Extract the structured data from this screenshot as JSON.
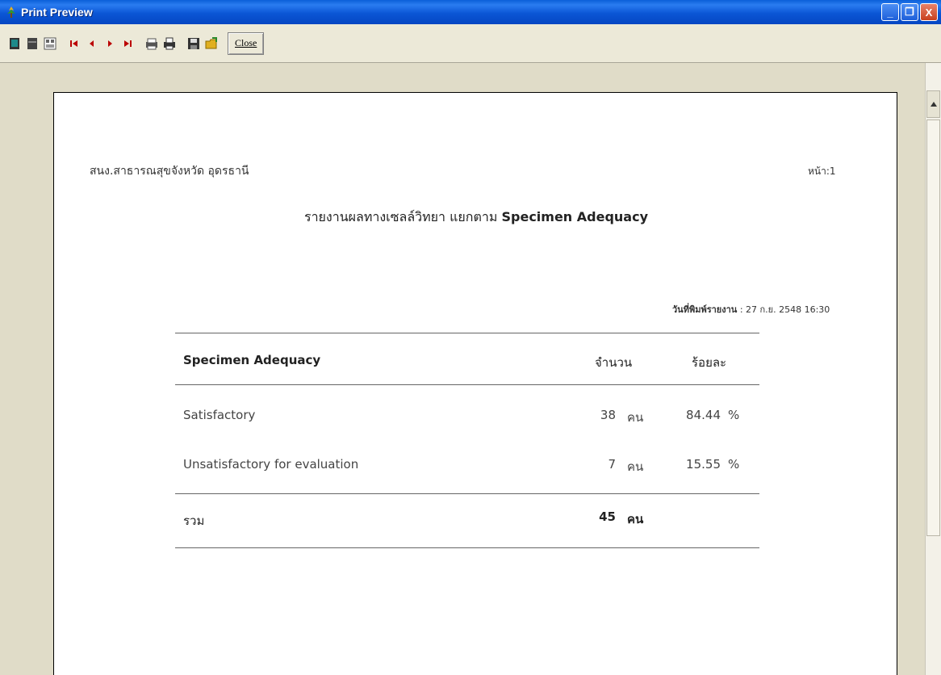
{
  "window": {
    "title": "Print Preview",
    "buttons": {
      "minimize": "_",
      "restore": "❐",
      "close": "X"
    }
  },
  "toolbar": {
    "close_label": "Close"
  },
  "report": {
    "org": "สนง.สาธารณสุขจังหวัด อุดรธานี",
    "page_label": "หน้า:1",
    "title_thai": "รายงานผลทางเซลล์วิทยา แยกตาม",
    "title_en": "Specimen Adequacy",
    "print_date_label": "วันที่พิมพ์รายงาน",
    "print_date_value": ": 27 ก.ย. 2548 16:30",
    "table": {
      "headers": {
        "category": "Specimen Adequacy",
        "count": "จำนวน",
        "percent": "ร้อยละ"
      },
      "rows": [
        {
          "category": "Satisfactory",
          "count": "38",
          "unit": "คน",
          "percent": "84.44",
          "pct_sign": "%"
        },
        {
          "category": "Unsatisfactory for evaluation",
          "count": "7",
          "unit": "คน",
          "percent": "15.55",
          "pct_sign": "%"
        }
      ],
      "total": {
        "label": "รวม",
        "count": "45",
        "unit": "คน"
      }
    }
  }
}
